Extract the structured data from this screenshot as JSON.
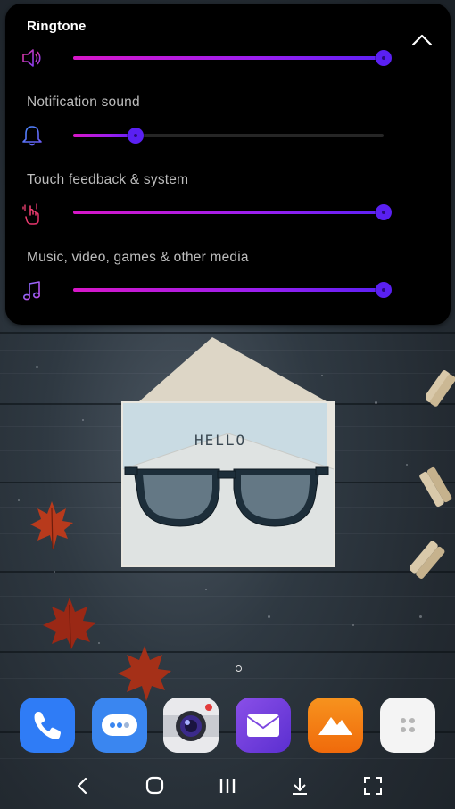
{
  "volume_panel": {
    "rows": [
      {
        "label": "Ringtone",
        "icon": "speaker-icon",
        "level": 1.0
      },
      {
        "label": "Notification sound",
        "icon": "bell-icon",
        "level": 0.2
      },
      {
        "label": "Touch feedback & system",
        "icon": "touch-vibration-icon",
        "level": 1.0
      },
      {
        "label": "Music, video, games & other media",
        "icon": "music-note-icon",
        "level": 1.0
      }
    ],
    "collapse_icon": "chevron-up-icon"
  },
  "wallpaper": {
    "letter_text": "HELLO"
  },
  "dock": {
    "apps": [
      {
        "icon": "phone-icon",
        "color": "#2f7cf6"
      },
      {
        "icon": "messages-icon",
        "color": "#3a86f0"
      },
      {
        "icon": "camera-icon",
        "color": "#f2f2f2"
      },
      {
        "icon": "email-icon",
        "color": "#7d47e0"
      },
      {
        "icon": "gallery-icon",
        "color": "#f57b14"
      },
      {
        "icon": "apps-folder-icon",
        "color": "#f4f4f4"
      }
    ]
  },
  "nav_bar": {
    "buttons": [
      "back-icon",
      "home-icon",
      "recents-icon",
      "hide-keyboard-icon",
      "fullscreen-icon"
    ]
  },
  "colors": {
    "accent_start": "#d817c8",
    "accent_end": "#5b21f5",
    "panel_background": "#000000"
  }
}
